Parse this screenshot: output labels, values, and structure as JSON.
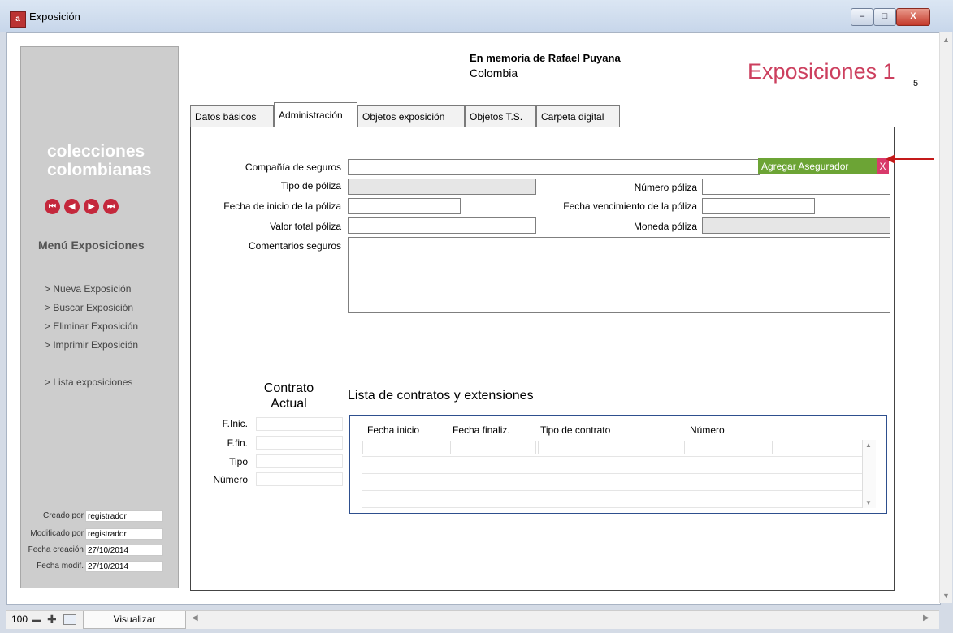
{
  "window": {
    "title": "Exposición",
    "icon": "app-document-icon",
    "controls": {
      "minimize": "‒",
      "maximize": "□",
      "close": "X"
    }
  },
  "sidebar": {
    "brand": "colecciones colombianas",
    "nav_buttons": [
      "⏮",
      "◀",
      "▶",
      "⏭"
    ],
    "menu_title": "Menú Exposiciones",
    "items": [
      "> Nueva Exposición",
      "> Buscar Exposición",
      "> Eliminar Exposición",
      "> Imprimir Exposición",
      "> Lista exposiciones"
    ],
    "meta": [
      {
        "label": "Creado por",
        "value": "registrador"
      },
      {
        "label": "Modificado por",
        "value": "registrador"
      },
      {
        "label": "Fecha creación",
        "value": "27/10/2014"
      },
      {
        "label": "Fecha modif.",
        "value": "27/10/2014"
      }
    ]
  },
  "header": {
    "memoria": "En memoria de Rafael Puyana",
    "pais": "Colombia",
    "title": "Exposiciones 1",
    "page_number": "5"
  },
  "tabs": [
    "Datos básicos",
    "Administración",
    "Objetos exposición",
    "Objetos T.S.",
    "Carpeta digital"
  ],
  "active_tab": "Administración",
  "form": {
    "compania_label": "Compañía de seguros",
    "compania_value": "",
    "agregar_label": "Agregar Asegurador",
    "agregar_x": "X",
    "tipo_label": "Tipo de póliza",
    "numero_label": "Número póliza",
    "fecha_inicio_label": "Fecha de inicio de la póliza",
    "fecha_venc_label": "Fecha vencimiento de la póliza",
    "valor_label": "Valor total póliza",
    "moneda_label": "Moneda póliza",
    "comentarios_label": "Comentarios seguros"
  },
  "contrato": {
    "title": "Contrato Actual",
    "fields": [
      "F.Inic.",
      "F.fin.",
      "Tipo",
      "Número"
    ]
  },
  "lista": {
    "title": "Lista de contratos y extensiones",
    "columns": [
      "Fecha inicio",
      "Fecha finaliz.",
      "Tipo de contrato",
      "Número"
    ]
  },
  "statusbar": {
    "zoom": "100",
    "view_label": "Visualizar"
  },
  "colors": {
    "accent_title": "#cc3f5e",
    "agregar_button": "#6ca435",
    "close_x": "#d83a6b",
    "annotation_arrow": "#c41a1a",
    "nav_buttons": "#c4283c"
  }
}
